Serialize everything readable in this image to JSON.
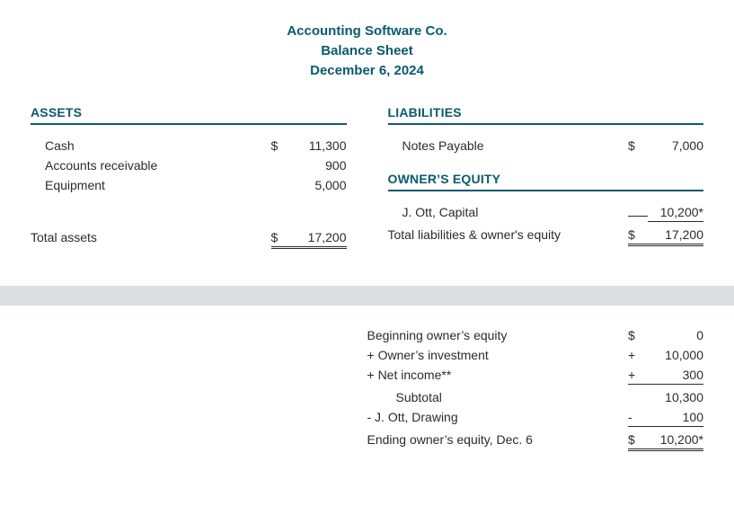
{
  "header": {
    "company": "Accounting Software Co.",
    "report": "Balance Sheet",
    "date": "December 6, 2024"
  },
  "assets": {
    "title": "ASSETS",
    "lines": [
      {
        "label": "Cash",
        "sym": "$",
        "amount": "11,300"
      },
      {
        "label": "Accounts receivable",
        "sym": "",
        "amount": "900"
      },
      {
        "label": "Equipment",
        "sym": "",
        "amount": "5,000"
      }
    ],
    "total": {
      "label": "Total assets",
      "sym": "$",
      "amount": "17,200"
    }
  },
  "liabilities": {
    "title": "LIABILITIES",
    "lines": [
      {
        "label": "Notes Payable",
        "sym": "$",
        "amount": "7,000"
      }
    ]
  },
  "equity": {
    "title": "OWNER’S EQUITY",
    "capital": {
      "label": "J. Ott, Capital",
      "sym": "",
      "amount": "10,200*"
    },
    "total": {
      "label": "Total liabilities & owner's equity",
      "sym": "$",
      "amount": "17,200"
    }
  },
  "reconcile": {
    "lines": [
      {
        "label": "Beginning owner’s equity",
        "sym": "$",
        "amount": "0",
        "style": ""
      },
      {
        "label": "+ Owner’s investment",
        "sym": "+",
        "amount": "10,000",
        "style": ""
      },
      {
        "label": "+ Net income**",
        "sym": "+",
        "amount": "300",
        "style": "underline-single"
      },
      {
        "label": "Subtotal",
        "sym": "",
        "amount": "10,300",
        "style": "",
        "indent": true
      },
      {
        "label": "- J. Ott, Drawing",
        "sym": "-",
        "amount": "100",
        "style": "underline-single"
      },
      {
        "label": "Ending owner’s equity, Dec. 6",
        "sym": "$",
        "amount": "10,200*",
        "style": "underline-double"
      }
    ]
  }
}
